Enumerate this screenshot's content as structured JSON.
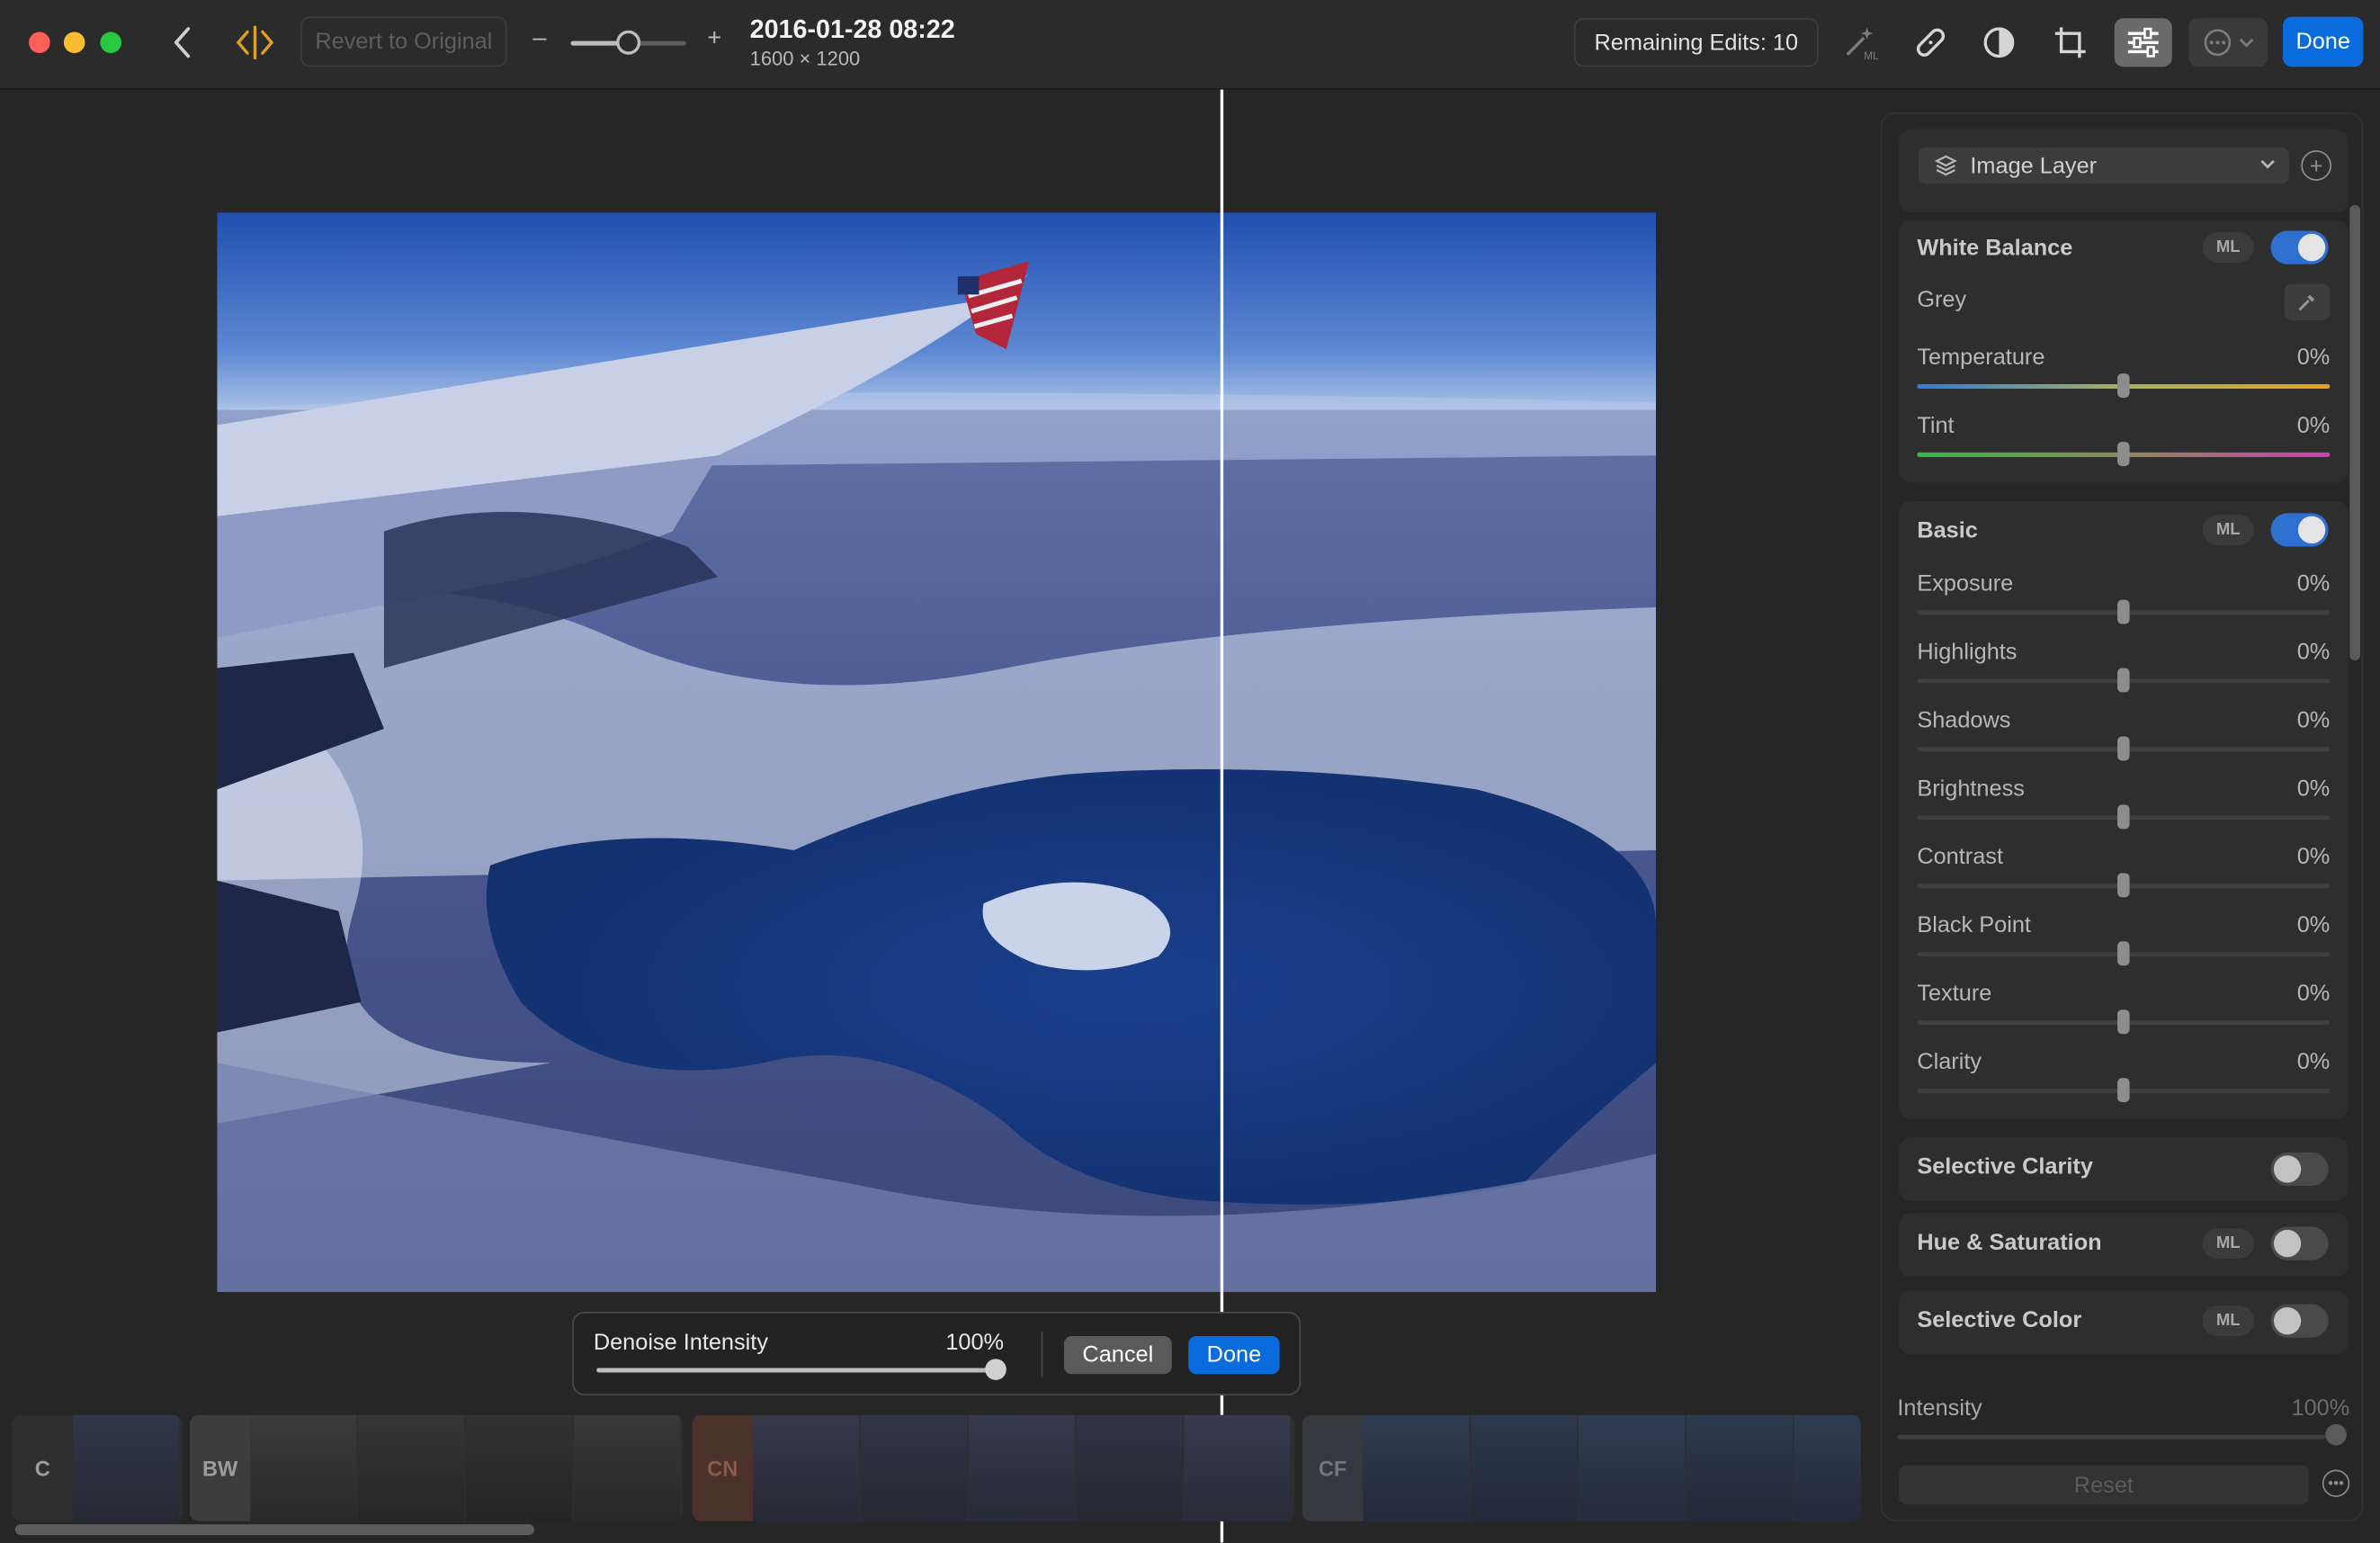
{
  "toolbar": {
    "revert_label": "Revert to Original",
    "zoom_minus": "–",
    "zoom_plus": "+",
    "zoom_level": 0.5,
    "title": "2016-01-28 08:22",
    "dimensions": "1600 × 1200",
    "remaining_edits": "Remaining Edits: 10",
    "done_label": "Done",
    "tools": [
      "magic-wand-icon",
      "bandage-icon",
      "mask-icon",
      "crop-icon",
      "adjustments-icon"
    ],
    "active_tool": "adjustments-icon"
  },
  "denoise": {
    "label": "Denoise Intensity",
    "value_text": "100%",
    "value": 1.0,
    "cancel_label": "Cancel",
    "done_label": "Done"
  },
  "filmstrip": {
    "groups": [
      {
        "label": "C",
        "accent": "#3a3a3a"
      },
      {
        "label": "BW",
        "accent": "#444444"
      },
      {
        "label": "CN",
        "accent": "#5a3a30"
      },
      {
        "label": "CF",
        "accent": "#3a3f45"
      }
    ]
  },
  "panel": {
    "layer_label": "Image Layer",
    "white_balance": {
      "title": "White Balance",
      "ml_badge": "ML",
      "enabled": true,
      "grey_label": "Grey",
      "sliders": [
        {
          "label": "Temperature",
          "value": "0%"
        },
        {
          "label": "Tint",
          "value": "0%"
        }
      ]
    },
    "basic": {
      "title": "Basic",
      "ml_badge": "ML",
      "enabled": true,
      "sliders": [
        {
          "label": "Exposure",
          "value": "0%"
        },
        {
          "label": "Highlights",
          "value": "0%"
        },
        {
          "label": "Shadows",
          "value": "0%"
        },
        {
          "label": "Brightness",
          "value": "0%"
        },
        {
          "label": "Contrast",
          "value": "0%"
        },
        {
          "label": "Black Point",
          "value": "0%"
        },
        {
          "label": "Texture",
          "value": "0%"
        },
        {
          "label": "Clarity",
          "value": "0%"
        }
      ]
    },
    "selective_clarity": {
      "title": "Selective Clarity",
      "enabled": false
    },
    "hue_saturation": {
      "title": "Hue & Saturation",
      "ml_badge": "ML",
      "enabled": false
    },
    "selective_color": {
      "title": "Selective Color",
      "ml_badge": "ML",
      "enabled": false
    },
    "intensity": {
      "label": "Intensity",
      "value": "100%"
    },
    "reset_label": "Reset"
  },
  "colors": {
    "accent_blue": "#0a6cdc",
    "toggle_on": "#2f6fcf"
  }
}
